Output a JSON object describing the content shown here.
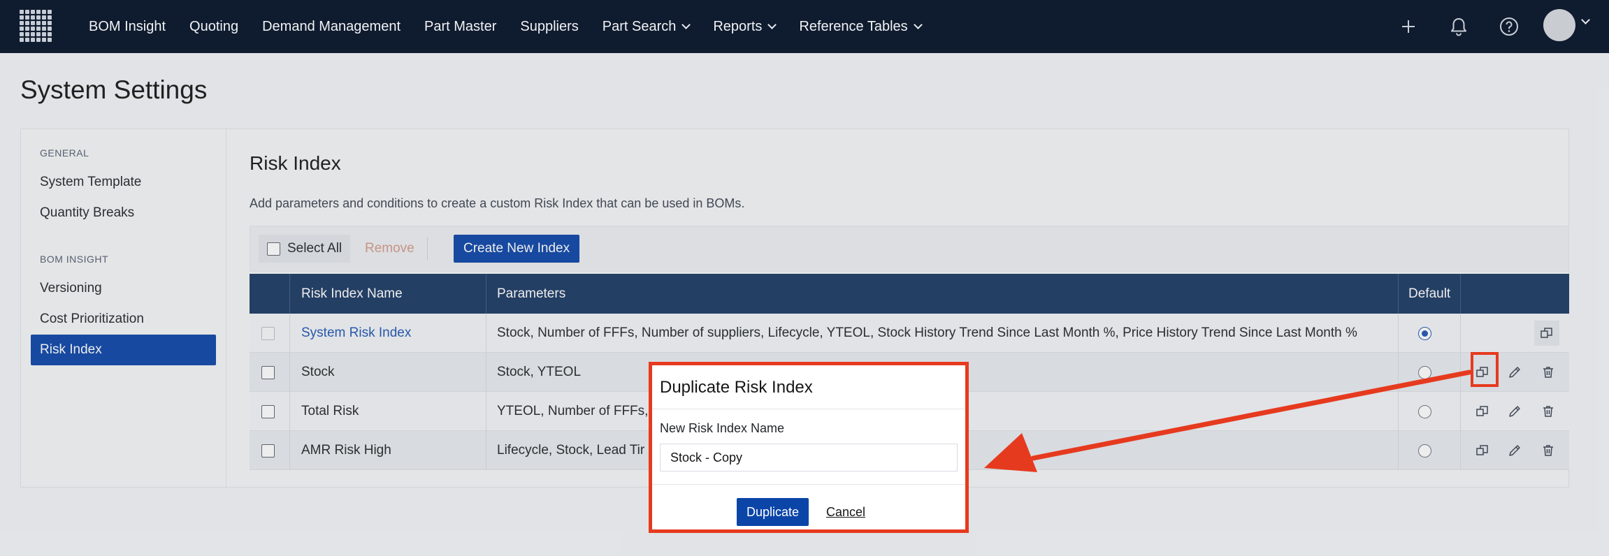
{
  "nav": {
    "items": [
      "BOM Insight",
      "Quoting",
      "Demand Management",
      "Part Master",
      "Suppliers",
      "Part Search",
      "Reports",
      "Reference Tables"
    ],
    "dropdown_items": [
      "Part Search",
      "Reports",
      "Reference Tables"
    ],
    "icons": [
      "apps-grid-icon",
      "plus-icon",
      "bell-icon",
      "help-icon",
      "avatar"
    ]
  },
  "page": {
    "title": "System Settings"
  },
  "sidebar": {
    "general_heading": "GENERAL",
    "general_items": [
      "System Template",
      "Quantity Breaks"
    ],
    "bom_heading": "BOM INSIGHT",
    "bom_items": [
      "Versioning",
      "Cost Prioritization",
      "Risk Index"
    ],
    "active": "Risk Index"
  },
  "section": {
    "title": "Risk Index",
    "description": "Add parameters and conditions to create a custom Risk Index that can be used in BOMs."
  },
  "toolbar": {
    "select_all": "Select All",
    "remove": "Remove",
    "create": "Create New Index"
  },
  "table": {
    "headers": [
      "Risk Index Name",
      "Parameters",
      "Default"
    ],
    "rows": [
      {
        "name": "System Risk Index",
        "params": "Stock, Number of FFFs, Number of suppliers, Lifecycle, YTEOL, Stock History Trend Since Last Month %, Price History Trend Since Last Month %",
        "default": true
      },
      {
        "name": "Stock",
        "params": "Stock, YTEOL",
        "default": false
      },
      {
        "name": "Total Risk",
        "params": "YTEOL, Number of FFFs,",
        "default": false
      },
      {
        "name": "AMR Risk High",
        "params": "Lifecycle, Stock, Lead Tir",
        "default": false
      }
    ]
  },
  "modal": {
    "title": "Duplicate Risk Index",
    "label": "New Risk Index Name",
    "value": "Stock - Copy",
    "confirm": "Duplicate",
    "cancel": "Cancel"
  },
  "colors": {
    "nav_bg": "#0f1b2e",
    "primary": "#0c45a8",
    "table_header": "#1b3a63",
    "annotation": "#e63a1f"
  }
}
